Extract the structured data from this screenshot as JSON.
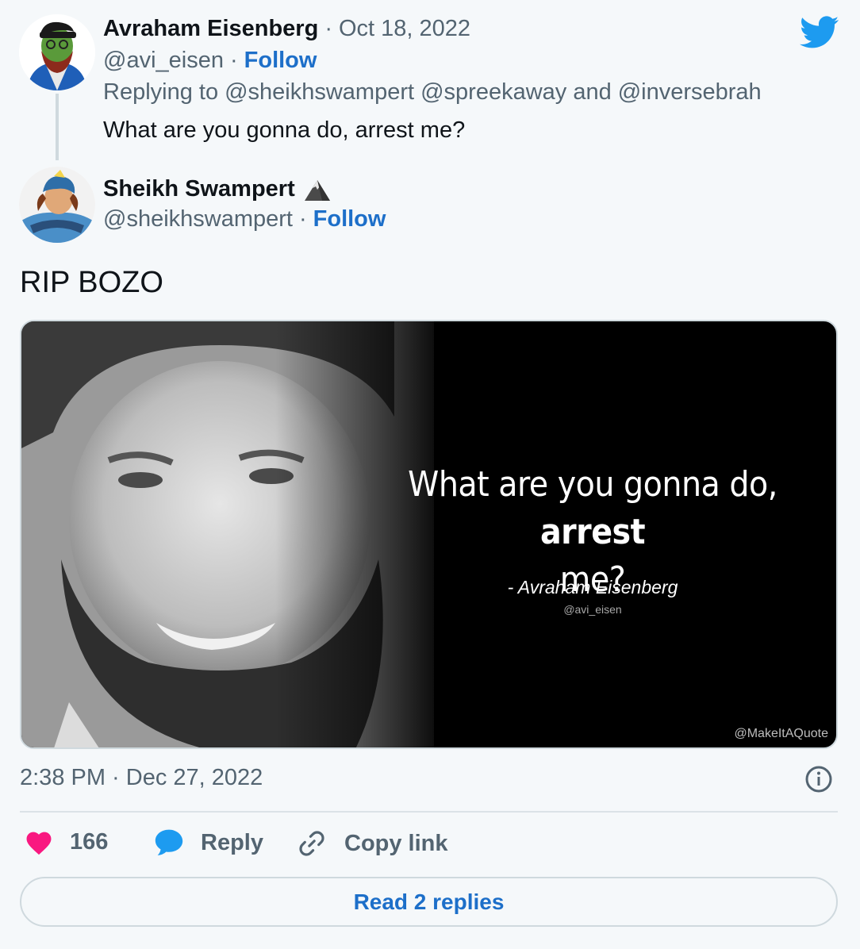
{
  "parent_tweet": {
    "author_name": "Avraham Eisenberg",
    "date": "Oct 18, 2022",
    "handle": "@avi_eisen",
    "follow_label": "Follow",
    "replying_prefix": "Replying to",
    "reply_mentions": "@sheikhswampert @spreekaway",
    "reply_and": "and",
    "reply_last": "@inversebrah",
    "text": "What are you gonna do, arrest me?"
  },
  "separator": "·",
  "main_tweet": {
    "author_name": "Sheikh Swampert",
    "handle": "@sheikhswampert",
    "follow_label": "Follow",
    "text": "RIP BOZO",
    "timestamp": "2:38 PM · Dec 27, 2022"
  },
  "media": {
    "quote_line1": "What are you gonna do,",
    "quote_bold": "arrest",
    "quote_line2": "me?",
    "attribution": "- Avraham Eisenberg",
    "attribution_handle": "@avi_eisen",
    "watermark": "@MakeItAQuote"
  },
  "actions": {
    "like_count": "166",
    "reply_label": "Reply",
    "copy_label": "Copy link"
  },
  "read_replies_label": "Read 2 replies",
  "colors": {
    "background": "#f5f8fa",
    "link_blue": "#1d6fc9",
    "twitter_blue": "#1d9bf0",
    "like_pink": "#f91880",
    "secondary_text": "#536471"
  },
  "icons": [
    "twitter-bird-icon",
    "mountain-emoji-icon",
    "heart-icon",
    "reply-bubble-icon",
    "link-icon",
    "info-icon"
  ]
}
